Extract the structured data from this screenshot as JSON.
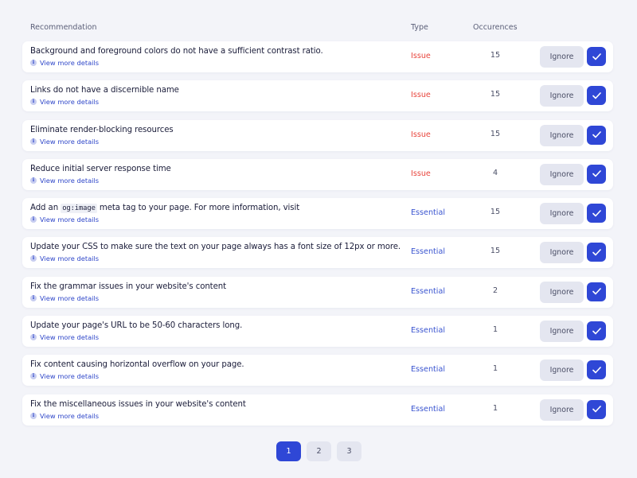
{
  "header": {
    "recommendation": "Recommendation",
    "type": "Type",
    "occurrences": "Occurences"
  },
  "rows": [
    {
      "title": "Background and foreground colors do not have a sufficient contrast ratio.",
      "details": "View more details",
      "type": "Issue",
      "occurrences": "15",
      "ignore": "Ignore"
    },
    {
      "title": "Links do not have a discernible name",
      "details": "View more details",
      "type": "Issue",
      "occurrences": "15",
      "ignore": "Ignore"
    },
    {
      "title": "Eliminate render-blocking resources",
      "details": "View more details",
      "type": "Issue",
      "occurrences": "15",
      "ignore": "Ignore"
    },
    {
      "title": "Reduce initial server response time",
      "details": "View more details",
      "type": "Issue",
      "occurrences": "4",
      "ignore": "Ignore"
    },
    {
      "title_prefix": "Add an",
      "title_code": "og:image",
      "title_suffix": "meta tag to your page. For more information, visit",
      "details": "View more details",
      "type": "Essential",
      "occurrences": "15",
      "ignore": "Ignore"
    },
    {
      "title": "Update your CSS to make sure the text on your page always has a font size of 12px or more.",
      "details": "View more details",
      "type": "Essential",
      "occurrences": "15",
      "ignore": "Ignore"
    },
    {
      "title": "Fix the grammar issues in your website's content",
      "details": "View more details",
      "type": "Essential",
      "occurrences": "2",
      "ignore": "Ignore"
    },
    {
      "title": "Update your page's URL to be 50-60 characters long.",
      "details": "View more details",
      "type": "Essential",
      "occurrences": "1",
      "ignore": "Ignore"
    },
    {
      "title": "Fix content causing horizontal overflow on your page.",
      "details": "View more details",
      "type": "Essential",
      "occurrences": "1",
      "ignore": "Ignore"
    },
    {
      "title": "Fix the miscellaneous issues in your website's content",
      "details": "View more details",
      "type": "Essential",
      "occurrences": "1",
      "ignore": "Ignore"
    }
  ],
  "pagination": {
    "pages": [
      "1",
      "2",
      "3"
    ],
    "current": "1"
  },
  "colors": {
    "primary": "#2f47d6",
    "issue": "#e8453c",
    "essential": "#3a55d0",
    "background": "#f3f4f9"
  },
  "icons": {
    "info": "info-icon",
    "check": "check-icon"
  }
}
